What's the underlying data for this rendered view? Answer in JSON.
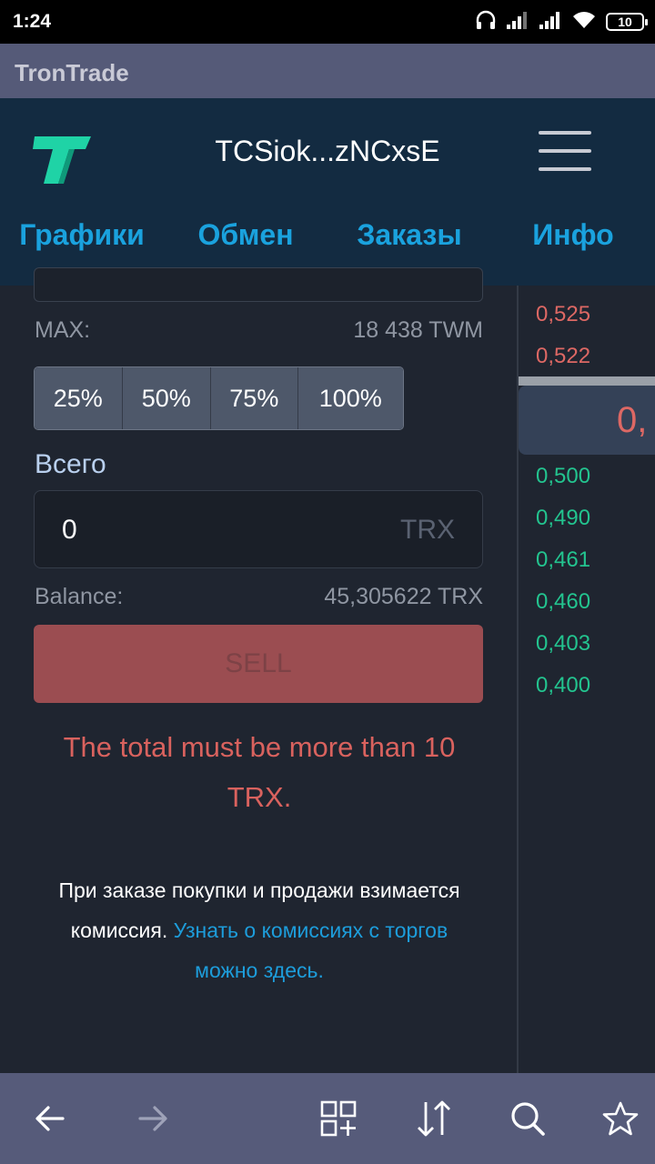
{
  "status_bar": {
    "time": "1:24",
    "battery": "10",
    "icons": [
      "headphones-icon",
      "signal-icon",
      "signal-icon",
      "wifi-icon",
      "battery-icon"
    ]
  },
  "browser": {
    "title": "TronTrade"
  },
  "header": {
    "logo_icon": "tron-logo-icon",
    "wallet": "TCSiok...zNCxsE",
    "menu_icon": "hamburger-menu-icon",
    "tabs": [
      {
        "label": "Графики",
        "active": false
      },
      {
        "label": "Обмен",
        "active": true
      },
      {
        "label": "Заказы",
        "active": false
      },
      {
        "label": "Инфо",
        "active": false
      }
    ]
  },
  "form": {
    "max_label": "MAX:",
    "max_value": "18 438 TWM",
    "percent_buttons": [
      "25%",
      "50%",
      "75%",
      "100%"
    ],
    "total_label": "Всего",
    "total_value": "0",
    "total_unit": "TRX",
    "balance_label": "Balance:",
    "balance_value": "45,305622 TRX",
    "sell_label": "SELL",
    "error": "The total must be more than 10 TRX.",
    "fee_text": "При заказе покупки и продажи взимается комиссия.",
    "fee_link": "Узнать о комиссиях с торгов можно здесь."
  },
  "order_book": {
    "sell_prices": [
      "0,525",
      "0,522"
    ],
    "current_price": "0,",
    "buy_prices": [
      "0,500",
      "0,490",
      "0,461",
      "0,460",
      "0,403",
      "0,400"
    ]
  },
  "colors": {
    "accent": "#1aa2de",
    "header_bg": "#132b41",
    "sell": "#dd6864",
    "buy": "#23c48f",
    "sell_button": "#9b4d51"
  },
  "bottom_nav": {
    "icons": [
      "back-arrow-icon",
      "forward-arrow-icon",
      "tabs-add-icon",
      "sort-arrows-icon",
      "search-icon",
      "star-icon"
    ]
  }
}
